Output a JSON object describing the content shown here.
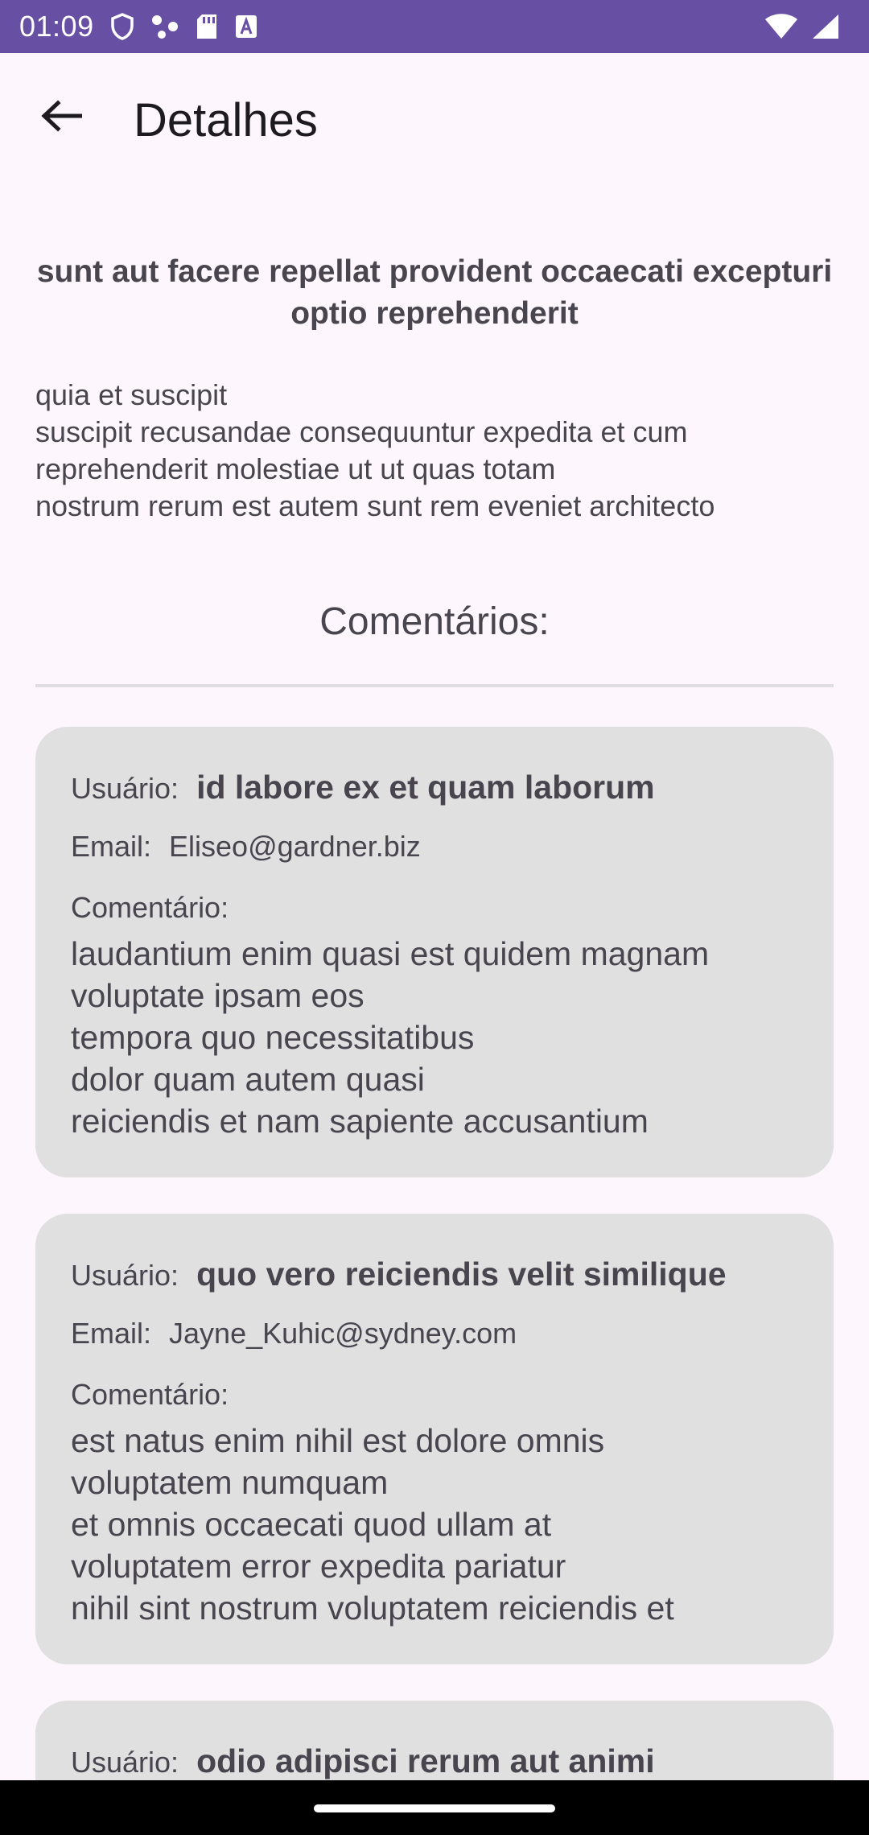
{
  "status_bar": {
    "time": "01:09",
    "left_icons": [
      "shield-icon",
      "share-nodes-icon",
      "sd-card-icon",
      "font-icon"
    ],
    "right_icons": [
      "wifi-icon",
      "signal-icon"
    ],
    "bg_color": "#6750a4"
  },
  "app_bar": {
    "back_icon": "arrow-back-icon",
    "title": "Detalhes"
  },
  "post": {
    "title": "sunt aut facere repellat provident occaecati excepturi optio reprehenderit",
    "body": "quia et suscipit\nsuscipit recusandae consequuntur expedita et cum\nreprehenderit molestiae ut ut quas totam\nnostrum rerum est autem sunt rem eveniet architecto"
  },
  "comments_heading": "Comentários:",
  "labels": {
    "user": "Usuário:",
    "email": "Email:",
    "comment": "Comentário:"
  },
  "comments": [
    {
      "name": "id labore ex et quam laborum",
      "email": "Eliseo@gardner.biz",
      "body": "laudantium enim quasi est quidem magnam\nvoluptate ipsam eos\ntempora quo necessitatibus\ndolor quam autem quasi\nreiciendis et nam sapiente accusantium"
    },
    {
      "name": "quo vero reiciendis velit similique",
      "email": "Jayne_Kuhic@sydney.com",
      "body": "est natus enim nihil est dolore omnis\nvoluptatem numquam\net omnis occaecati quod ullam at\nvoluptatem error expedita pariatur\nnihil sint nostrum voluptatem reiciendis et"
    },
    {
      "name": "odio adipisci rerum aut animi",
      "email": "",
      "body": ""
    }
  ],
  "colors": {
    "background": "#fdf7fd",
    "card": "#e0e0e0",
    "text": "#49454f",
    "accent": "#6750a4"
  }
}
